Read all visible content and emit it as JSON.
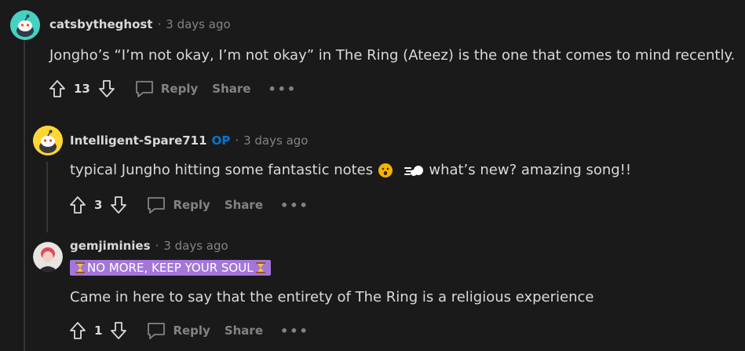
{
  "comments": [
    {
      "username": "catsbytheghost",
      "time": "3 days ago",
      "body": "Jongho’s “I’m not okay, I’m not okay” in The Ring (Ateez) is the one that comes to mind recently.",
      "score": "13",
      "reply_label": "Reply",
      "share_label": "Share",
      "more_label": "•••"
    },
    {
      "username": "Intelligent-Spare711",
      "op_badge": "OP",
      "time": "3 days ago",
      "body_part1": "typical Jungho hitting some fantastic notes",
      "body_part2": " what’s new? amazing song!!",
      "score": "3",
      "reply_label": "Reply",
      "share_label": "Share",
      "more_label": "•••"
    },
    {
      "username": "gemjiminies",
      "time": "3 days ago",
      "flair": "NO MORE, KEEP YOUR SOUL",
      "body": "Came in here to say that the entirety of The Ring is a religious experience",
      "score": "1",
      "reply_label": "Reply",
      "share_label": "Share",
      "more_label": "•••"
    }
  ],
  "separator": "·",
  "colors": {
    "background": "#1a1a1b",
    "text": "#d7dadc",
    "muted": "#818384",
    "op_blue": "#0079d3",
    "flair_purple": "#a476d9"
  }
}
